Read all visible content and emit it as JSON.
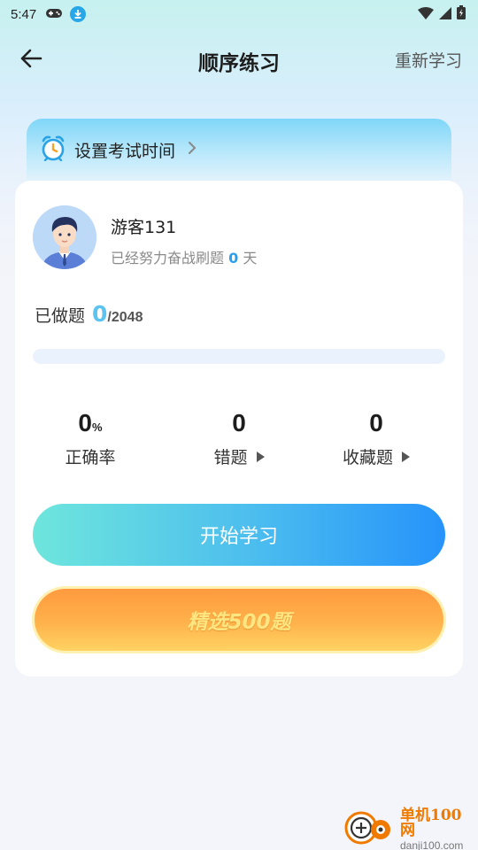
{
  "status_bar": {
    "time": "5:47",
    "left_icons": [
      "gamepad-icon",
      "download-icon"
    ],
    "right_icons": [
      "wifi-icon",
      "signal-icon",
      "battery-icon"
    ]
  },
  "nav": {
    "title": "顺序练习",
    "right_action": "重新学习",
    "back_icon": "arrow-left-icon"
  },
  "exam_time": {
    "label": "设置考试时间",
    "icon": "alarm-clock-icon"
  },
  "user": {
    "name": "游客131",
    "sub_prefix": "已经努力奋战刷题",
    "days": "0",
    "sub_suffix": "天"
  },
  "progress": {
    "label": "已做题",
    "done": "0",
    "total": "/2048",
    "fraction": 0
  },
  "stats": {
    "accuracy": {
      "value": "0",
      "unit": "%",
      "label": "正确率"
    },
    "wrong": {
      "value": "0",
      "label": "错题"
    },
    "favorites": {
      "value": "0",
      "label": "收藏题"
    }
  },
  "buttons": {
    "start": "开始学习",
    "selected": "精选500题"
  },
  "watermark": {
    "name": "单机100网",
    "url": "danji100.com"
  },
  "colors": {
    "accent_blue": "#2593fb",
    "accent_teal": "#6ee6dc",
    "accent_orange": "#ff9a3e",
    "highlight_num": "#2a9ff1"
  }
}
